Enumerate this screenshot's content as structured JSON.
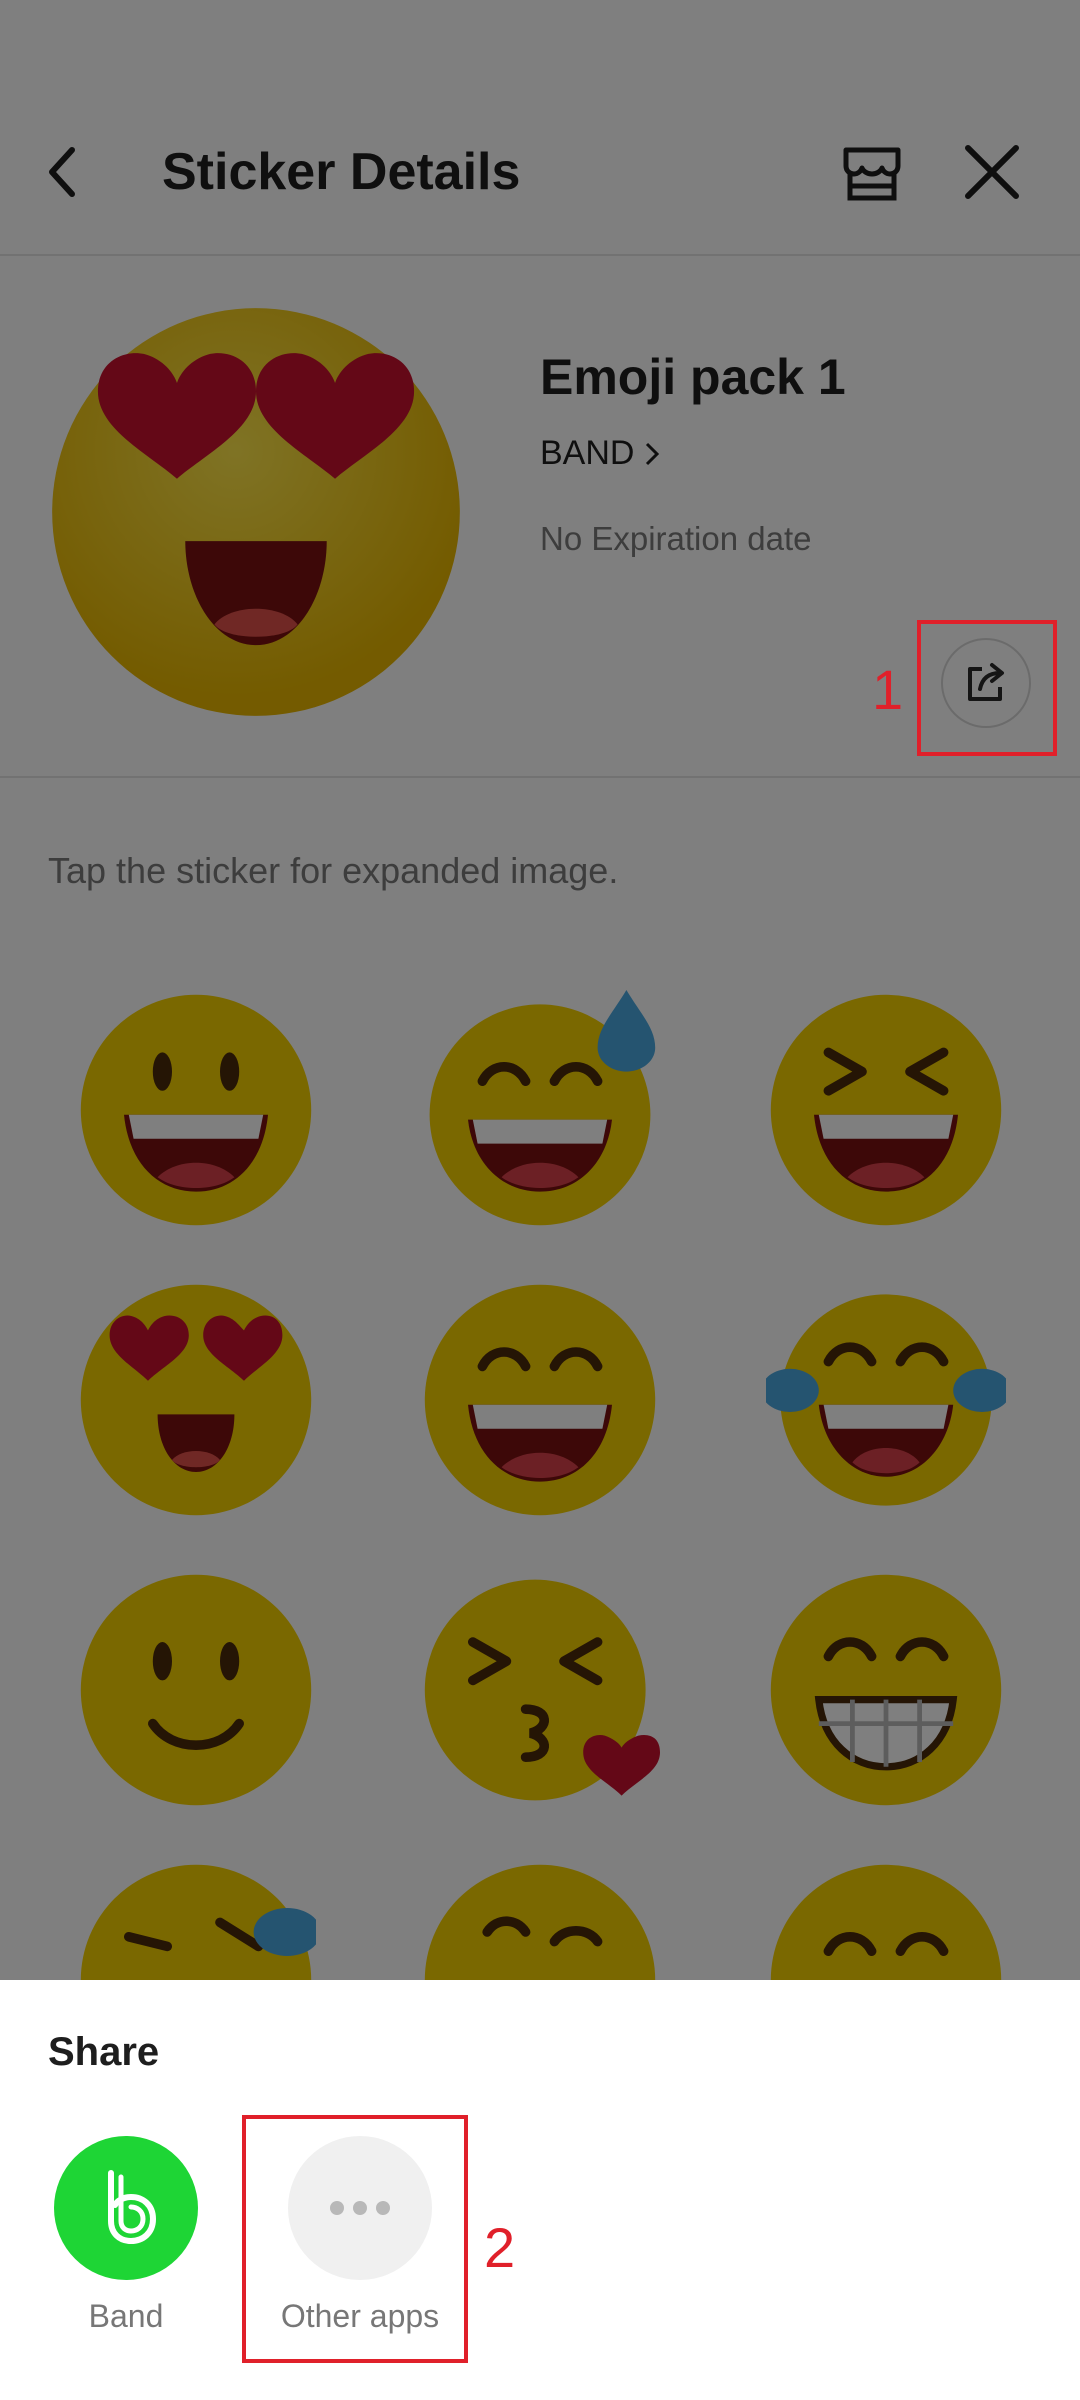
{
  "header": {
    "title": "Sticker Details"
  },
  "pack": {
    "name": "Emoji pack 1",
    "publisher": "BAND",
    "expiry": "No Expiration date"
  },
  "hint": "Tap the sticker for expanded image.",
  "annotations": {
    "one": "1",
    "two": "2"
  },
  "stickers": [
    "grinning-emoji",
    "sweat-smile-emoji",
    "squinting-laugh-emoji",
    "heart-eyes-emoji",
    "smile-emoji",
    "tears-of-joy-emoji",
    "slight-smile-emoji",
    "kiss-emoji",
    "beaming-emoji",
    "rolling-laugh-emoji",
    "wink-emoji",
    "grin-emoji"
  ],
  "share_sheet": {
    "title": "Share",
    "apps": [
      {
        "label": "Band",
        "icon": "band-app-icon",
        "color": "#1ed535"
      },
      {
        "label": "Other apps",
        "icon": "more-dots-icon",
        "color": "#f0f0f0"
      }
    ]
  },
  "colors": {
    "highlight": "#e0202a",
    "band": "#1ed535",
    "emoji": "#f5d000"
  }
}
